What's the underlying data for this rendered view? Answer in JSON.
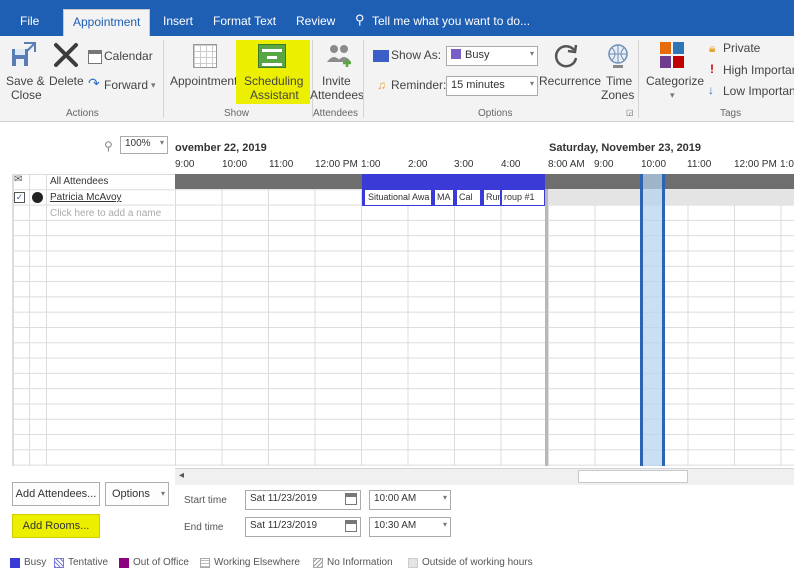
{
  "tabs": {
    "file": "File",
    "appointment": "Appointment",
    "insert": "Insert",
    "format_text": "Format Text",
    "review": "Review",
    "tell_me": "Tell me what you want to do..."
  },
  "ribbon": {
    "actions": {
      "save_close_1": "Save &",
      "save_close_2": "Close",
      "delete": "Delete",
      "calendar": "Calendar",
      "forward": "Forward",
      "group": "Actions"
    },
    "show": {
      "appointment": "Appointment",
      "scheduling_1": "Scheduling",
      "scheduling_2": "Assistant",
      "group": "Show"
    },
    "attendees": {
      "invite_1": "Invite",
      "invite_2": "Attendees",
      "group": "Attendees"
    },
    "options": {
      "show_as_label": "Show As:",
      "show_as_value": "Busy",
      "reminder_label": "Reminder:",
      "reminder_value": "15 minutes",
      "recurrence": "Recurrence",
      "time_zones_1": "Time",
      "time_zones_2": "Zones",
      "group": "Options"
    },
    "tags": {
      "categorize": "Categorize",
      "private": "Private",
      "high": "High Importar",
      "low": "Low Importan",
      "group": "Tags"
    }
  },
  "scheduler": {
    "zoom": "100%",
    "day1_label": "ovember 22, 2019",
    "day2_label": "Saturday, November 23, 2019",
    "day1_times": [
      "9:00",
      "10:00",
      "11:00",
      "12:00 PM",
      "1:00",
      "2:00",
      "3:00",
      "4:00"
    ],
    "day2_times": [
      "8:00 AM",
      "9:00",
      "10:00",
      "11:00",
      "12:00 PM",
      "1:0"
    ],
    "all_attendees": "All Attendees",
    "attendee": "Patricia McAvoy",
    "add_name_placeholder": "Click here to add a name",
    "busy_blocks": [
      "Situational Awa",
      "MA",
      "Cal",
      "Run",
      "roup #1"
    ],
    "collapse_arrow": "◂"
  },
  "bottom": {
    "add_attendees": "Add Attendees...",
    "options": "Options",
    "add_rooms": "Add Rooms...",
    "start_label": "Start time",
    "start_date": "Sat 11/23/2019",
    "start_time": "10:00 AM",
    "end_label": "End time",
    "end_date": "Sat 11/23/2019",
    "end_time": "10:30 AM"
  },
  "legend": {
    "busy": "Busy",
    "tentative": "Tentative",
    "out_of_office": "Out of Office",
    "working_elsewhere": "Working Elsewhere",
    "no_information": "No Information",
    "outside_hours": "Outside of working hours"
  },
  "colors": {
    "tab_blue": "#1e5fb4",
    "highlight": "#ecf000",
    "busy": "#3a3ad6",
    "out_of_office": "#8b0080",
    "selection_border": "#2b64b4",
    "selection_fill": "#cfe3f6"
  }
}
